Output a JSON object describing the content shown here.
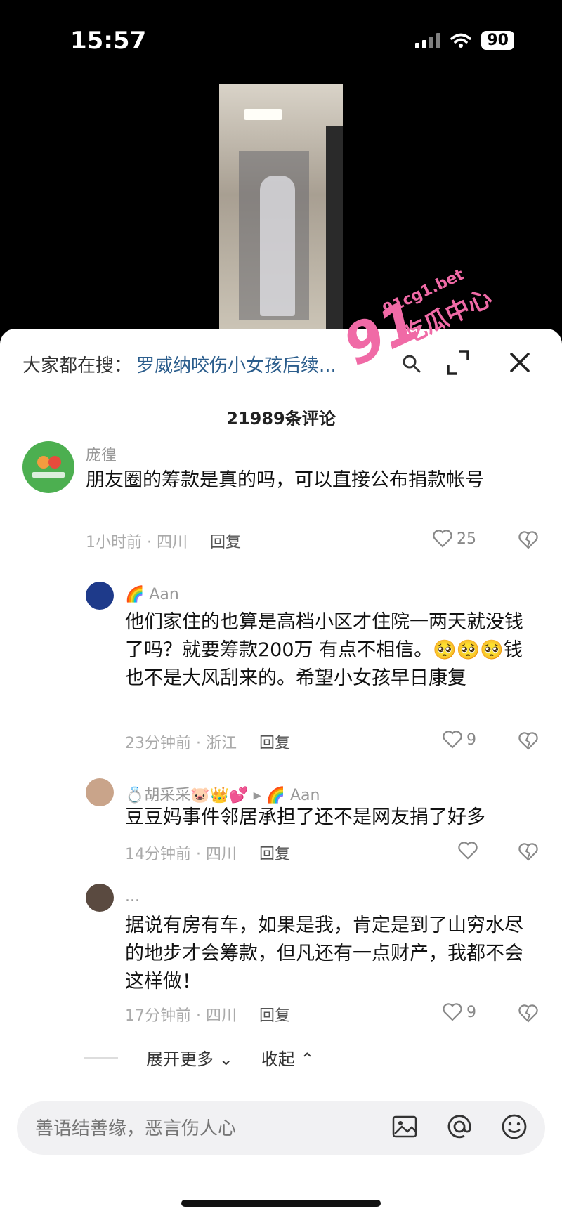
{
  "status": {
    "time": "15:57",
    "battery": "90"
  },
  "search": {
    "prefix": "大家都在搜：",
    "term": "罗威纳咬伤小女孩后续..."
  },
  "comments_count": "21989条评论",
  "comments": [
    {
      "user": "庞徨",
      "text": "朋友圈的筹款是真的吗，可以直接公布捐款帐号",
      "meta": "1小时前 · 四川",
      "reply": "回复",
      "likes": "25"
    },
    {
      "user": "🌈 Aan",
      "text": "他们家住的也算是高档小区才住院一两天就没钱了吗？就要筹款200万 有点不相信。🥺🥺🥺钱也不是大风刮来的。希望小女孩早日康复",
      "meta": "23分钟前 · 浙江",
      "reply": "回复",
      "likes": "9"
    },
    {
      "user": "💍胡采采🐷👑💕 ▸ 🌈 Aan",
      "text": "豆豆妈事件邻居承担了还不是网友捐了好多",
      "meta": "14分钟前 · 四川",
      "reply": "回复",
      "likes": ""
    },
    {
      "user": "...",
      "text": "据说有房有车，如果是我，肯定是到了山穷水尽的地步才会筹款，但凡还有一点财产，我都不会这样做！",
      "meta": "17分钟前 · 四川",
      "reply": "回复",
      "likes": "9"
    }
  ],
  "expand": {
    "more": "展开更多",
    "collapse": "收起"
  },
  "input": {
    "placeholder": "善语结善缘，恶言伤人心"
  },
  "watermark": {
    "logo": "91",
    "site": "91cg1.bet",
    "name": "吃瓜中心"
  },
  "colors": {
    "accent_blue": "#2b5d8c",
    "watermark_pink": "#f06aa6"
  }
}
